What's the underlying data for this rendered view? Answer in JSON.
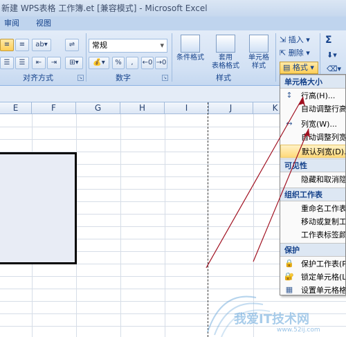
{
  "window": {
    "title": "新建 WPS表格 工作簿.et  [兼容模式] - Microsoft Excel"
  },
  "tabs": [
    {
      "label": "审阅"
    },
    {
      "label": "视图"
    }
  ],
  "ribbon": {
    "groups": {
      "alignment": {
        "label": "对齐方式"
      },
      "number": {
        "label": "数字",
        "format_value": "常规"
      },
      "styles": {
        "label": "样式",
        "conditional": "条件格式",
        "table_format_1": "套用",
        "table_format_2": "表格格式",
        "cell_style_1": "单元格",
        "cell_style_2": "样式"
      },
      "cells": {
        "insert": "插入",
        "delete": "删除",
        "format": "格式"
      }
    },
    "sigma": "Σ"
  },
  "columns": [
    "E",
    "F",
    "G",
    "H",
    "I",
    "J",
    "K"
  ],
  "format_menu": {
    "sections": [
      {
        "title": "单元格大小",
        "items": [
          "行高(H)...",
          "自动调整行高",
          "列宽(W)...",
          "自动调整列宽",
          "默认列宽(D)..."
        ]
      },
      {
        "title": "可见性",
        "items": [
          "隐藏和取消隐藏"
        ]
      },
      {
        "title": "组织工作表",
        "items": [
          "重命名工作表",
          "移动或复制工作表",
          "工作表标签颜色"
        ]
      },
      {
        "title": "保护",
        "items": [
          "保护工作表(P)",
          "锁定单元格(L)",
          "设置单元格格式"
        ]
      }
    ]
  },
  "watermark": {
    "text": "我爱IT技术网",
    "url": "www.52ij.com"
  },
  "colors": {
    "accent": "#15428b",
    "highlight": "#ffd97b",
    "arrow": "#a01020"
  }
}
